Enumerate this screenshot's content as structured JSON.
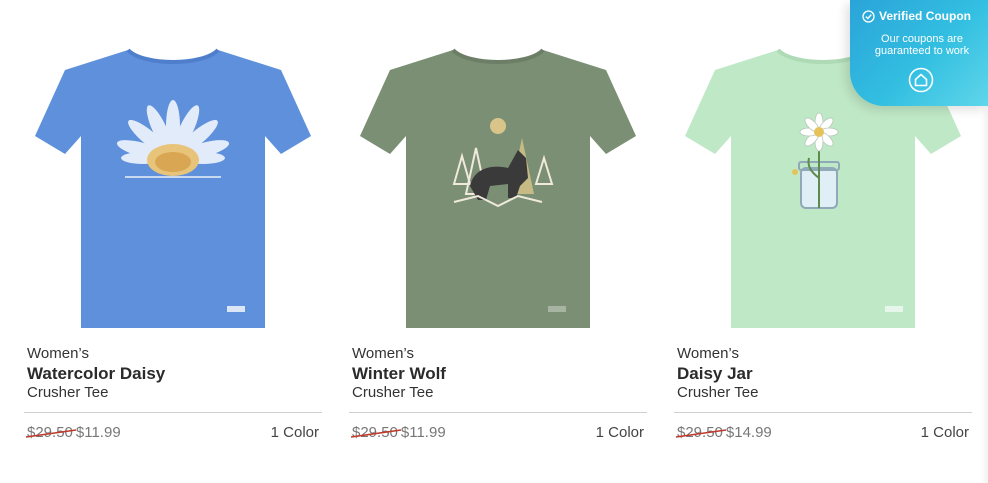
{
  "products": [
    {
      "category": "Women’s",
      "name": "Watercolor Daisy",
      "style": "Crusher Tee",
      "original_price": "$29.50",
      "sale_price": "$11.99",
      "colors": "1 Color",
      "shirt_color": "#5e90dc",
      "graphic": "watercolor-daisy-graphic"
    },
    {
      "category": "Women’s",
      "name": "Winter Wolf",
      "style": "Crusher Tee",
      "original_price": "$29.50",
      "sale_price": "$11.99",
      "colors": "1 Color",
      "shirt_color": "#7b8f74",
      "graphic": "winter-wolf-graphic"
    },
    {
      "category": "Women’s",
      "name": "Daisy Jar",
      "style": "Crusher Tee",
      "original_price": "$29.50",
      "sale_price": "$14.99",
      "colors": "1 Color",
      "shirt_color": "#bfe8c6",
      "graphic": "daisy-jar-graphic"
    }
  ],
  "coupon": {
    "title": "Verified Coupon",
    "subtitle": "Our coupons are guaranteed to work",
    "icon": "home-icon",
    "check_icon": "check-circle-icon"
  },
  "colors": {
    "strike": "#c0392b",
    "coupon_gradient_start": "#2aa4d9",
    "coupon_gradient_end": "#5fd6ea"
  }
}
